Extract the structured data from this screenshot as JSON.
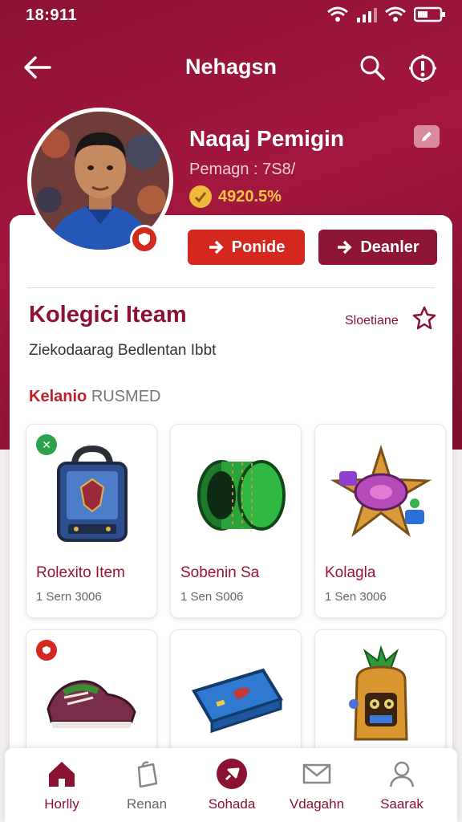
{
  "status": {
    "time": "18:911"
  },
  "appbar": {
    "title": "Nehagsn",
    "back_icon": "arrow-left-icon",
    "search_icon": "search-icon",
    "alert_icon": "alert-icon"
  },
  "profile": {
    "name": "Naqaj Pemigin",
    "subtitle": "Pemagn : 7S8/",
    "coins": "4920.5%",
    "badge_icon": "shield-icon",
    "edit_icon": "edit-icon"
  },
  "actions": {
    "primary_label": "Ponide",
    "secondary_label": "Deanler"
  },
  "collection": {
    "title": "Kolegici Iteam",
    "link": "Sloetiane",
    "description": "Ziekodaarag Bedlentan Ibbt",
    "sub_heading_accent": "Kelanio",
    "sub_heading_rest": "RUSMED"
  },
  "items": [
    {
      "name": "Rolexito Item",
      "meta": "1 Sern 3006",
      "icon": "backpack-icon"
    },
    {
      "name": "Sobenin Sa",
      "meta": "1 Sen S006",
      "icon": "green-ring-icon"
    },
    {
      "name": "Kolagla",
      "meta": "1 Sen 3006",
      "icon": "gem-emblem-icon"
    },
    {
      "name": "",
      "meta": "",
      "icon": "sneakers-icon"
    },
    {
      "name": "",
      "meta": "",
      "icon": "blue-case-icon"
    },
    {
      "name": "",
      "meta": "",
      "icon": "pineapple-character-icon"
    }
  ],
  "nav": [
    {
      "label": "Horlly",
      "icon": "home-icon"
    },
    {
      "label": "Renan",
      "icon": "bag-icon"
    },
    {
      "label": "Sohada",
      "icon": "pin-icon"
    },
    {
      "label": "Vdagahn",
      "icon": "mail-icon"
    },
    {
      "label": "Saarak",
      "icon": "profile-icon"
    }
  ],
  "colors": {
    "brand": "#a3173e",
    "accent_red": "#d4281f",
    "coin_gold": "#f3c341"
  }
}
